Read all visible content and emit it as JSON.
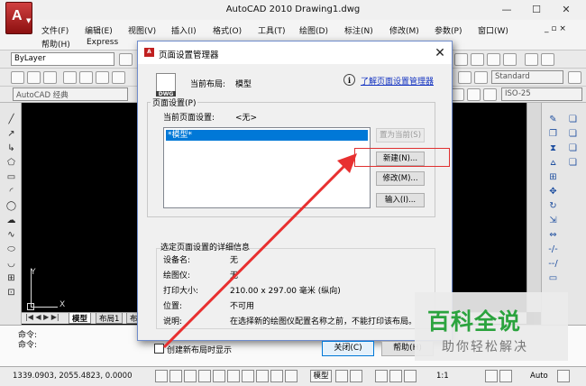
{
  "window": {
    "title": "AutoCAD 2010    Drawing1.dwg",
    "controls": [
      "—",
      "☐",
      "✕"
    ]
  },
  "menu": {
    "items": [
      "文件(F)",
      "编辑(E)",
      "视图(V)",
      "插入(I)",
      "格式(O)",
      "工具(T)",
      "绘图(D)",
      "标注(N)",
      "修改(M)",
      "参数(P)",
      "窗口(W)",
      "帮助(H)",
      "Express"
    ],
    "doc_controls": "_ ▫ ×"
  },
  "toolbars": {
    "layer_dropdown": "ByLayer",
    "workspace_dropdown": "AutoCAD 经典",
    "text_style": "Standard",
    "dim_style": "ISO-25"
  },
  "canvas": {
    "ucs_x": "X",
    "ucs_y": "Y"
  },
  "layout_tabs": [
    "模型",
    "布局1",
    "布"
  ],
  "command": {
    "lines": [
      "命令:",
      "命令:"
    ]
  },
  "status": {
    "coords": "1339.0903, 2055.4823, 0.0000",
    "model_btn": "模型",
    "scale": "1:1",
    "auto": "Auto"
  },
  "dialog": {
    "title": "页面设置管理器",
    "current_layout_label": "当前布局:",
    "current_layout_value": "模型",
    "learn_link": "了解页面设置管理器",
    "group1_legend": "页面设置(P)",
    "current_setup_label": "当前页面设置:",
    "current_setup_value": "<无>",
    "list_items": [
      "*模型*"
    ],
    "buttons": {
      "set_current": "置为当前(S)",
      "new": "新建(N)...",
      "modify": "修改(M)...",
      "import": "输入(I)..."
    },
    "details_legend": "选定页面设置的详细信息",
    "details": [
      {
        "label": "设备名:",
        "value": "无"
      },
      {
        "label": "绘图仪:",
        "value": "无"
      },
      {
        "label": "打印大小:",
        "value": "210.00 x 297.00 毫米 (纵向)"
      },
      {
        "label": "位置:",
        "value": "不可用"
      },
      {
        "label": "说明:",
        "value": "在选择新的绘图仪配置名称之前，不能打印该布局。"
      }
    ],
    "checkbox_label": "创建新布局时显示",
    "close_btn": "关闭(C)",
    "help_btn": "帮助(H)"
  },
  "watermark": {
    "main": "百科全说",
    "sub": "助你轻松解决"
  }
}
